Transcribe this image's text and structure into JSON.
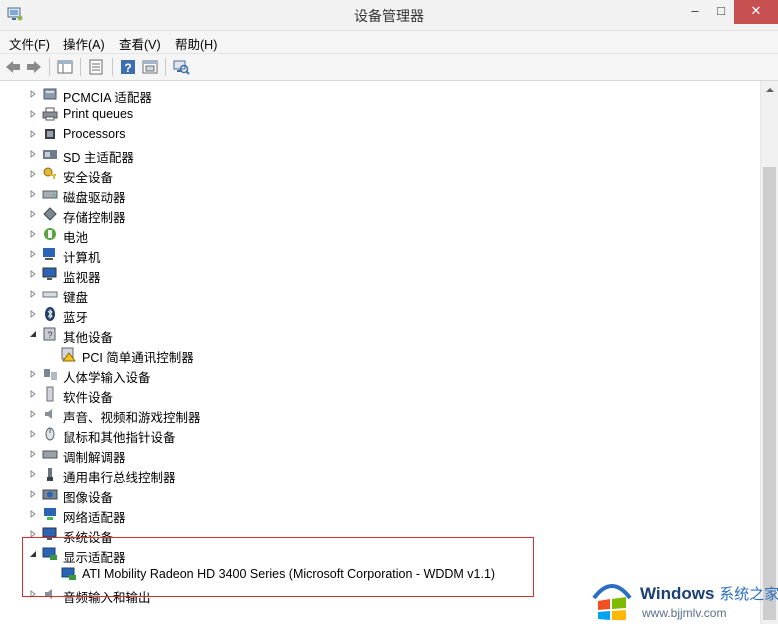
{
  "window": {
    "title": "设备管理器",
    "minimize_glyph": "–",
    "maximize_glyph": "□",
    "close_glyph": "✕"
  },
  "menu": [
    {
      "label": "文件(F)"
    },
    {
      "label": "操作(A)"
    },
    {
      "label": "查看(V)"
    },
    {
      "label": "帮助(H)"
    }
  ],
  "toolbar": {
    "buttons": [
      "back-icon",
      "forward-icon",
      "properties-view-icon",
      "device-list-icon",
      "help-icon",
      "details-view-icon",
      "scan-hardware-icon"
    ]
  },
  "tree": {
    "items": [
      {
        "label": "PCMCIA 适配器",
        "level": 1,
        "expanded": false,
        "icon": "pcmcia-icon"
      },
      {
        "label": "Print queues",
        "level": 1,
        "expanded": false,
        "icon": "printer-icon"
      },
      {
        "label": "Processors",
        "level": 1,
        "expanded": false,
        "icon": "processor-icon"
      },
      {
        "label": "SD 主适配器",
        "level": 1,
        "expanded": false,
        "icon": "sd-host-icon"
      },
      {
        "label": "安全设备",
        "level": 1,
        "expanded": false,
        "icon": "security-key-icon"
      },
      {
        "label": "磁盘驱动器",
        "level": 1,
        "expanded": false,
        "icon": "disk-drive-icon"
      },
      {
        "label": "存储控制器",
        "level": 1,
        "expanded": false,
        "icon": "storage-controller-icon"
      },
      {
        "label": "电池",
        "level": 1,
        "expanded": false,
        "icon": "battery-icon"
      },
      {
        "label": "计算机",
        "level": 1,
        "expanded": false,
        "icon": "computer-icon"
      },
      {
        "label": "监视器",
        "level": 1,
        "expanded": false,
        "icon": "monitor-icon"
      },
      {
        "label": "键盘",
        "level": 1,
        "expanded": false,
        "icon": "keyboard-icon"
      },
      {
        "label": "蓝牙",
        "level": 1,
        "expanded": false,
        "icon": "bluetooth-icon"
      },
      {
        "label": "其他设备",
        "level": 1,
        "expanded": true,
        "icon": "other-devices-icon"
      },
      {
        "label": "PCI 简单通讯控制器",
        "level": 2,
        "expanded": null,
        "icon": "warning-device-icon"
      },
      {
        "label": "人体学输入设备",
        "level": 1,
        "expanded": false,
        "icon": "hid-icon"
      },
      {
        "label": "软件设备",
        "level": 1,
        "expanded": false,
        "icon": "software-device-icon"
      },
      {
        "label": "声音、视频和游戏控制器",
        "level": 1,
        "expanded": false,
        "icon": "speaker-icon"
      },
      {
        "label": "鼠标和其他指针设备",
        "level": 1,
        "expanded": false,
        "icon": "mouse-icon"
      },
      {
        "label": "调制解调器",
        "level": 1,
        "expanded": false,
        "icon": "modem-icon"
      },
      {
        "label": "通用串行总线控制器",
        "level": 1,
        "expanded": false,
        "icon": "usb-icon"
      },
      {
        "label": "图像设备",
        "level": 1,
        "expanded": false,
        "icon": "camera-icon"
      },
      {
        "label": "网络适配器",
        "level": 1,
        "expanded": false,
        "icon": "network-adapter-icon"
      },
      {
        "label": "系统设备",
        "level": 1,
        "expanded": false,
        "icon": "system-device-icon"
      },
      {
        "label": "显示适配器",
        "level": 1,
        "expanded": true,
        "icon": "display-adapter-icon"
      },
      {
        "label": "ATI Mobility Radeon HD 3400 Series (Microsoft Corporation - WDDM v1.1)",
        "level": 2,
        "expanded": null,
        "icon": "display-adapter-icon"
      },
      {
        "label": "音频输入和输出",
        "level": 1,
        "expanded": false,
        "icon": "audio-io-icon"
      }
    ]
  },
  "watermark": {
    "brand": "Windows",
    "brand_cn": "系统之家",
    "url": "www.bjjmlv.com"
  },
  "colors": {
    "highlight_border": "#d2302c",
    "close_button": "#c75050"
  }
}
